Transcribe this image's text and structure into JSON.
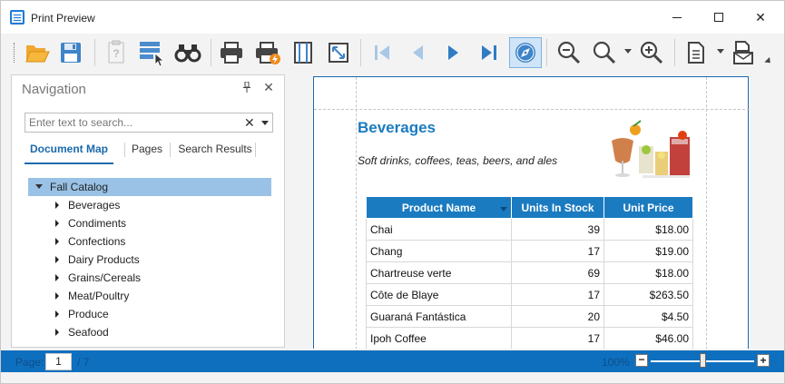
{
  "window": {
    "title": "Print Preview",
    "minimize_icon": "minimize-icon",
    "maximize_icon": "maximize-icon",
    "close_glyph": "✕"
  },
  "toolbar": {
    "buttons": [
      {
        "name": "open-button",
        "icon": "folder-open-icon"
      },
      {
        "name": "save-button",
        "icon": "floppy-disk-icon"
      },
      {
        "name": "parameters-button",
        "icon": "parameters-icon",
        "disabled": true
      },
      {
        "name": "editing-fields-button",
        "icon": "editing-fields-icon"
      },
      {
        "name": "search-button",
        "icon": "binoculars-icon"
      },
      {
        "name": "print-button",
        "icon": "printer-icon"
      },
      {
        "name": "quick-print-button",
        "icon": "printer-lightning-icon"
      },
      {
        "name": "page-setup-button",
        "icon": "page-margins-icon"
      },
      {
        "name": "scale-button",
        "icon": "scale-arrows-icon"
      },
      {
        "name": "first-page-button",
        "icon": "first-page-icon",
        "disabled": true
      },
      {
        "name": "previous-page-button",
        "icon": "previous-page-icon",
        "disabled": true
      },
      {
        "name": "next-page-button",
        "icon": "next-page-icon"
      },
      {
        "name": "last-page-button",
        "icon": "last-page-icon"
      },
      {
        "name": "navigation-pane-button",
        "icon": "compass-icon",
        "active": true
      },
      {
        "name": "zoom-out-button",
        "icon": "zoom-out-icon"
      },
      {
        "name": "zoom-button",
        "icon": "zoom-icon"
      },
      {
        "name": "zoom-in-button",
        "icon": "zoom-in-icon"
      },
      {
        "name": "export-button",
        "icon": "export-document-icon"
      },
      {
        "name": "send-button",
        "icon": "send-document-icon"
      }
    ]
  },
  "navigation": {
    "title": "Navigation",
    "pin_icon": "pin-icon",
    "close_glyph": "✕",
    "search": {
      "placeholder": "Enter text to search...",
      "value": "",
      "clear_glyph": "✕"
    },
    "tabs": [
      {
        "label": "Document Map",
        "active": true
      },
      {
        "label": "Pages",
        "active": false
      },
      {
        "label": "Search Results",
        "active": false
      }
    ],
    "tree": {
      "root": "Fall Catalog",
      "items": [
        "Beverages",
        "Condiments",
        "Confections",
        "Dairy Products",
        "Grains/Cereals",
        "Meat/Poultry",
        "Produce",
        "Seafood"
      ]
    }
  },
  "document": {
    "category_title": "Beverages",
    "category_description": "Soft drinks, coffees, teas, beers, and ales",
    "image_icon": "beverages-photo",
    "table": {
      "headers": [
        "Product Name",
        "Units In Stock",
        "Unit Price"
      ],
      "rows": [
        [
          "Chai",
          "39",
          "$18.00"
        ],
        [
          "Chang",
          "17",
          "$19.00"
        ],
        [
          "Chartreuse verte",
          "69",
          "$18.00"
        ],
        [
          "Côte de Blaye",
          "17",
          "$263.50"
        ],
        [
          "Guaraná Fantástica",
          "20",
          "$4.50"
        ],
        [
          "Ipoh Coffee",
          "17",
          "$46.00"
        ]
      ]
    }
  },
  "status": {
    "page_label": "Page:",
    "page_value": "1",
    "page_total": "/ 7",
    "zoom_label": "100%",
    "zoom_minus": "−",
    "zoom_plus": "+",
    "zoom_percent": 100
  },
  "colors": {
    "accent": "#1b7bc0",
    "status_bar": "#0f6fbf",
    "selection": "#99c2e6",
    "window_bg": "#f3f3f3"
  }
}
